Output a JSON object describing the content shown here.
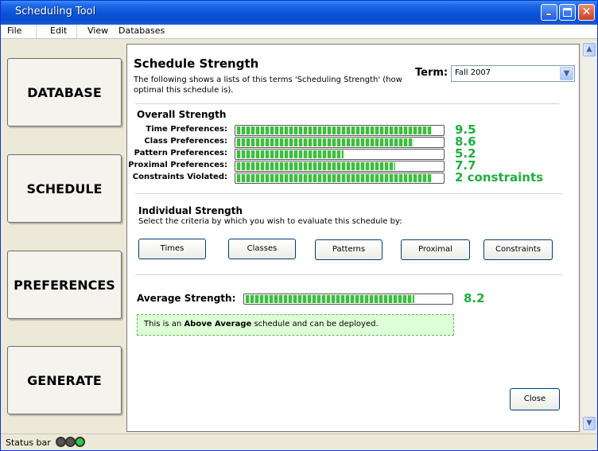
{
  "window": {
    "title": "Scheduling Tool"
  },
  "menu": [
    "File",
    "Edit",
    "View",
    "Databases"
  ],
  "nav": [
    "DATABASE",
    "SCHEDULE",
    "PREFERENCES",
    "GENERATE"
  ],
  "panel": {
    "title": "Schedule Strength",
    "description_line1": "The following shows a lists of this terms 'Scheduling Strength' (how",
    "description_line2": "optimal this schedule is).",
    "term_label": "Term:",
    "term_value": "Fall 2007"
  },
  "overall": {
    "heading": "Overall Strength",
    "rows": [
      {
        "label": "Time Preferences:",
        "value": "9.5",
        "fill": 0.95
      },
      {
        "label": "Class Preferences:",
        "value": "8.6",
        "fill": 0.86
      },
      {
        "label": "Pattern Preferences:",
        "value": "5.2",
        "fill": 0.52
      },
      {
        "label": "Proximal Preferences:",
        "value": "7.7",
        "fill": 0.77
      },
      {
        "label": "Constraints Violated:",
        "value": "2 constraints",
        "fill": 0.95
      }
    ]
  },
  "individual": {
    "heading": "Individual Strength",
    "subtitle": "Select the criteria by which you wish to evaluate this schedule by:",
    "buttons": [
      "Times",
      "Classes",
      "Patterns",
      "Proximal",
      "Constraints"
    ]
  },
  "average": {
    "label": "Average Strength:",
    "value": "8.2",
    "fill": 0.82
  },
  "notice": {
    "prefix": "This is an ",
    "emphasis": "Above Average",
    "suffix": " schedule and can be deployed."
  },
  "close_label": "Close",
  "status_bar": {
    "text": "Status bar",
    "lights": [
      "#555555",
      "#555555",
      "#2ecc40"
    ]
  },
  "colors": {
    "accent_green": "#1FAF3D",
    "titlebar_blue": "#0A52D8"
  }
}
